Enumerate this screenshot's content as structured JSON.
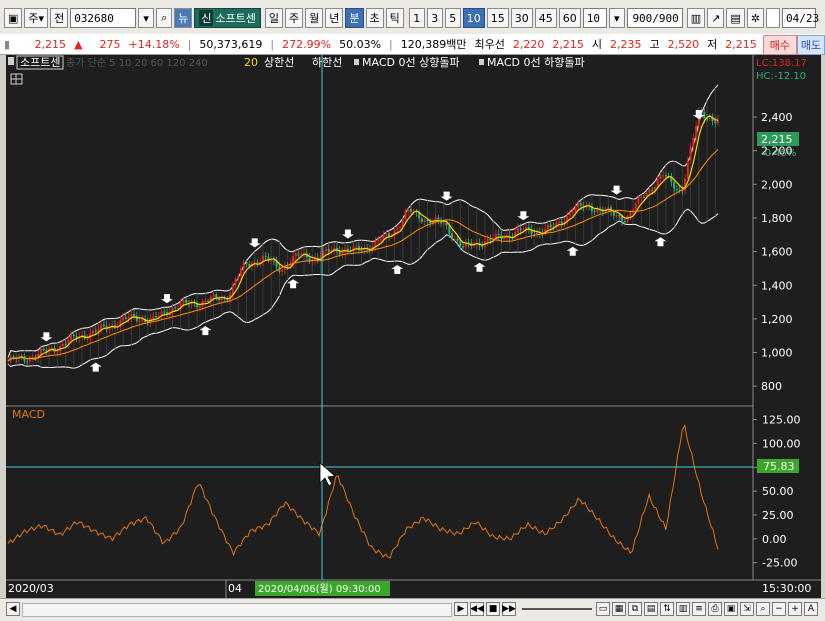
{
  "toolbar": {
    "period_type": "주",
    "prev_label": "전",
    "stock_code": "032680",
    "news_label": "뉴",
    "credit_label": "신",
    "stock_name": "소프트센",
    "period_buttons": [
      "일",
      "주",
      "월",
      "년",
      "분",
      "초",
      "틱"
    ],
    "active_period": "분",
    "interval_buttons": [
      "1",
      "3",
      "5",
      "10",
      "15",
      "30",
      "45",
      "60"
    ],
    "active_interval": "10",
    "interval_select": "10",
    "count_display": "900/900",
    "date_value": "04/23"
  },
  "quote": {
    "price": "2,215",
    "change": "275",
    "change_pct": "+14.18%",
    "volume": "50,373,619",
    "volume_ratio": "272.99%",
    "ratio2": "50.03%",
    "amount": "120,389백만",
    "best_label": "최우선",
    "best_price": "2,220",
    "best_price2": "2,215",
    "open_label": "시",
    "open_price": "2,235",
    "high_label": "고",
    "high_price": "2,520",
    "low_label": "저",
    "low_price": "2,215",
    "buy_label": "매수",
    "sell_label": "매도"
  },
  "chart": {
    "legend_name": "소프트센",
    "legend_ma": "종가 단순 5 10 20 60 120 240",
    "legend_bb_period": "20",
    "legend_bb_upper": "상한선",
    "legend_bb_lower": "하한선",
    "legend_signal_up": "MACD 0선 상향돌파",
    "legend_signal_down": "MACD 0선 하향돌파",
    "lc_label": "LC:138.17",
    "hc_label": "HC:-12.10",
    "current_price_tag": "2,215",
    "current_change_tag": "-0.45%",
    "macd_label": "MACD",
    "macd_value_tag": "75.83",
    "x_label_left": "2020/03",
    "x_label_mid": "04",
    "crosshair_label": "2020/04/06(월) 09:30:00",
    "x_label_right": "15:30:00",
    "colors": {
      "background": "#1e1e1e",
      "candle_up": "#e0261c",
      "candle_down": "#2fb07a",
      "ma_short": "#ffd400",
      "ma_long": "#ff8a00",
      "bollinger": "#ffffff",
      "macd_line": "#e0740c",
      "crosshair": "#3fd0e0",
      "price_tag": "#2b9a5a",
      "macd_tag": "#3aa72a"
    }
  },
  "chart_data": [
    {
      "type": "line",
      "title": "",
      "y_ticks": [
        800,
        1000,
        1200,
        1400,
        1600,
        1800,
        2000,
        2200,
        2400
      ],
      "ylim": [
        700,
        2650
      ],
      "series": [
        {
          "name": "",
          "values": [
            950,
            970,
            1000,
            1050,
            1100,
            1130,
            1180,
            1210,
            1190,
            1270,
            1290,
            1310,
            1330,
            1520,
            1560,
            1500,
            1580,
            1560,
            1620,
            1600,
            1640,
            1700,
            1840,
            1790,
            1760,
            1620,
            1660,
            1680,
            1720,
            1720,
            1740,
            1850,
            1870,
            1830,
            1800,
            1950,
            2050,
            1960,
            2440,
            2360
          ]
        }
      ]
    },
    {
      "type": "line",
      "title": "",
      "y_ticks": [
        -25,
        0,
        25,
        50,
        75,
        100,
        125
      ],
      "ylim": [
        -40,
        135
      ],
      "series": [
        {
          "name": "MACD",
          "values": [
            -5,
            8,
            14,
            4,
            18,
            8,
            0,
            15,
            22,
            -5,
            12,
            60,
            20,
            -15,
            8,
            15,
            38,
            20,
            5,
            68,
            25,
            -10,
            -20,
            10,
            22,
            10,
            5,
            18,
            2,
            0,
            15,
            5,
            20,
            42,
            22,
            0,
            -15,
            45,
            10,
            122,
            50,
            -10
          ]
        }
      ]
    }
  ]
}
